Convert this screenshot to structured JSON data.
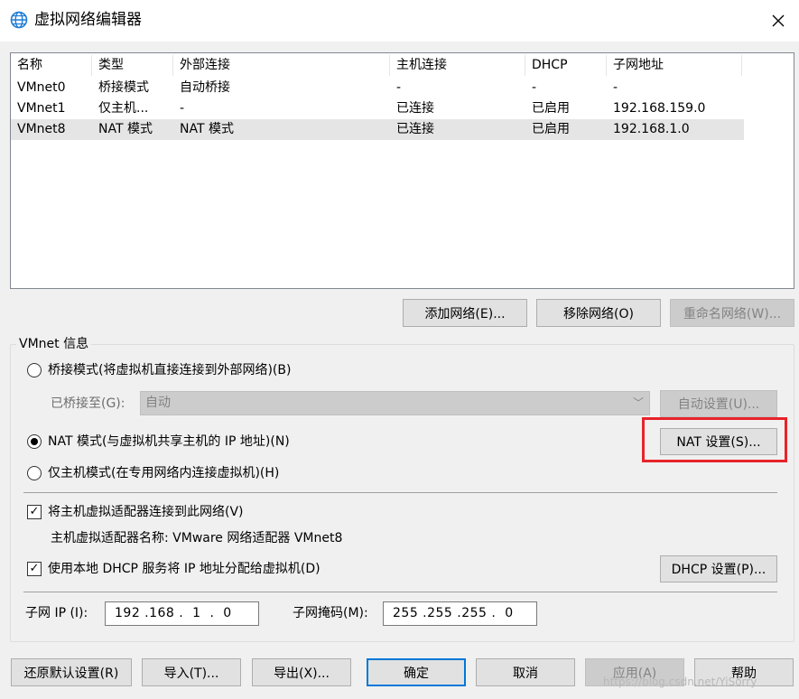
{
  "window": {
    "title": "虚拟网络编辑器",
    "icon": "globe-network-icon",
    "close_glyph": "✕"
  },
  "network_list": {
    "columns": [
      "名称",
      "类型",
      "外部连接",
      "主机连接",
      "DHCP",
      "子网地址"
    ],
    "rows": [
      {
        "name": "VMnet0",
        "type": "桥接模式",
        "external": "自动桥接",
        "host": "-",
        "dhcp": "-",
        "subnet": "-"
      },
      {
        "name": "VMnet1",
        "type": "仅主机...",
        "external": "-",
        "host": "已连接",
        "dhcp": "已启用",
        "subnet": "192.168.159.0"
      },
      {
        "name": "VMnet8",
        "type": "NAT 模式",
        "external": "NAT 模式",
        "host": "已连接",
        "dhcp": "已启用",
        "subnet": "192.168.1.0"
      }
    ],
    "selected_row": 2
  },
  "list_buttons": {
    "add": "添加网络(E)...",
    "remove": "移除网络(O)",
    "rename": "重命名网络(W)..."
  },
  "vmnet_info": {
    "group_label": "VMnet 信息",
    "bridged_radio": "桥接模式(将虚拟机直接连接到外部网络)(B)",
    "bridged_to_label": "已桥接至(G):",
    "bridged_to_value": "自动",
    "auto_settings_button": "自动设置(U)...",
    "nat_radio": "NAT 模式(与虚拟机共享主机的 IP 地址)(N)",
    "nat_settings_button": "NAT 设置(S)...",
    "host_only_radio": "仅主机模式(在专用网络内连接虚拟机)(H)",
    "selected_mode": "nat",
    "connect_adapter_checkbox": "将主机虚拟适配器连接到此网络(V)",
    "adapter_name_text": "主机虚拟适配器名称: VMware 网络适配器 VMnet8",
    "use_dhcp_checkbox": "使用本地 DHCP 服务将 IP 地址分配给虚拟机(D)",
    "dhcp_settings_button": "DHCP 设置(P)...",
    "subnet_ip_label": "子网 IP (I):",
    "subnet_ip_value": "192 .168 .  1  .  0",
    "subnet_mask_label": "子网掩码(M):",
    "subnet_mask_value": "255 .255 .255 .  0",
    "check_glyph": "✓"
  },
  "footer_buttons": {
    "restore": "还原默认设置(R)",
    "import": "导入(T)...",
    "export": "导出(X)...",
    "ok": "确定",
    "cancel": "取消",
    "apply": "应用(A)",
    "help": "帮助"
  },
  "watermark": "https://blog.csdn.net/YiSorry",
  "colors": {
    "highlight_box": "#e8232a",
    "default_button_border": "#0078d7",
    "icon_blue": "#1e7bd6"
  }
}
